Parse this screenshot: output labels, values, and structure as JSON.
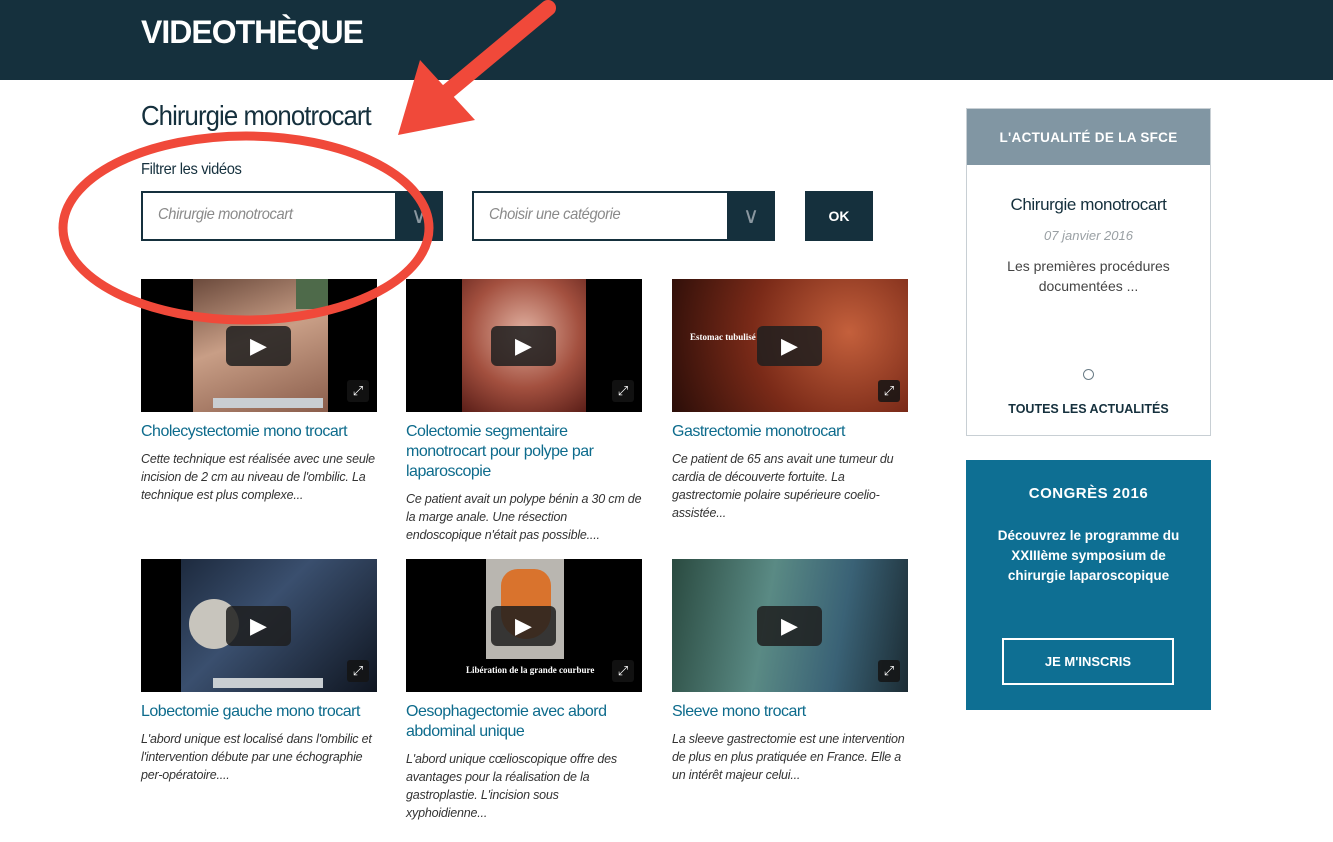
{
  "header": {
    "brand": "VIDEOTHÈQUE"
  },
  "main": {
    "title": "Chirurgie monotrocart",
    "filter_label": "Filtrer les vidéos",
    "filter_1_value": "Chirurgie monotrocart",
    "filter_2_placeholder": "Choisir une catégorie",
    "ok_label": "OK"
  },
  "videos": [
    {
      "title": "Cholecystectomie mono trocart",
      "desc": "Cette technique est réalisée avec une seule incision de 2 cm au niveau de l'ombilic. La technique est plus complexe..."
    },
    {
      "title": "Colectomie segmentaire monotrocart pour polype par laparoscopie",
      "desc": "Ce patient avait un polype bénin a 30 cm de la marge anale. Une résection endoscopique n'était pas possible...."
    },
    {
      "title": "Gastrectomie monotrocart",
      "desc": "Ce patient de 65 ans avait une tumeur du cardia de découverte fortuite. La gastrectomie polaire supérieure coelio-assistée...",
      "thumb_caption": "Estomac tubulisé"
    },
    {
      "title": "Lobectomie gauche mono trocart",
      "desc": "L'abord unique est localisé dans l'ombilic et l'intervention débute par une échographie per-opératoire...."
    },
    {
      "title": "Oesophagectomie avec abord abdominal unique",
      "desc": "L'abord unique cœlioscopique offre des avantages pour la réalisation de la gastroplastie. L'incision sous xyphoidienne...",
      "thumb_caption": "Libération de la grande courbure"
    },
    {
      "title": "Sleeve mono trocart",
      "desc": "La sleeve gastrectomie est une intervention de plus en plus pratiquée en France. Elle a un intérêt majeur celui..."
    }
  ],
  "sidebar": {
    "news": {
      "heading": "L'ACTUALITÉ DE LA SFCE",
      "title": "Chirurgie monotrocart",
      "date": "07 janvier 2016",
      "text": "Les premières procédures documentées ...",
      "link": "TOUTES LES ACTUALITÉS"
    },
    "congress": {
      "heading": "CONGRÈS 2016",
      "text": "Découvrez le programme du XXIIIème symposium de chirurgie laparoscopique",
      "button": "JE M'INSCRIS"
    }
  },
  "colors": {
    "header_bg": "#15303d",
    "link": "#0d6b8c",
    "congress_bg": "#0e6f93",
    "news_head": "#8196a3",
    "annotation": "#f0493a"
  }
}
